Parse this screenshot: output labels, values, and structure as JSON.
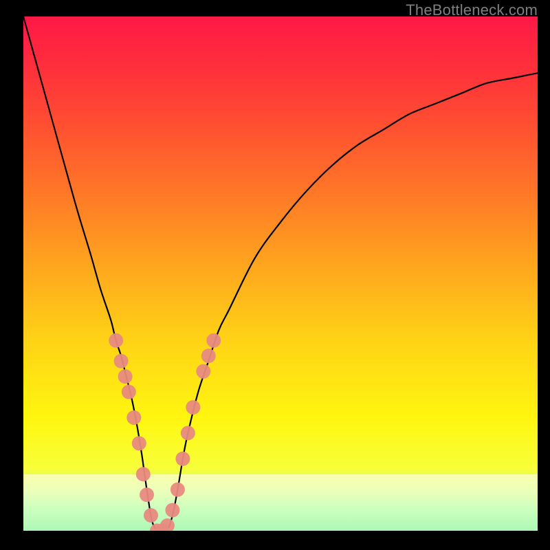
{
  "watermark": "TheBottleneck.com",
  "colors": {
    "frame": "#000000",
    "curve": "#000000",
    "marker_fill": "#e88a80",
    "marker_stroke": "#e88a80",
    "highlight_band": "rgba(255,255,220,0.68)"
  },
  "chart_data": {
    "type": "line",
    "title": "",
    "xlabel": "",
    "ylabel": "",
    "xlim": [
      0,
      100
    ],
    "ylim": [
      0,
      100
    ],
    "grid": false,
    "x": [
      0,
      5,
      10,
      13,
      15,
      17,
      18,
      19,
      20,
      21,
      22,
      23,
      24,
      25,
      26,
      27,
      28,
      29,
      30,
      31,
      32,
      34,
      36,
      38,
      40,
      45,
      50,
      55,
      60,
      65,
      70,
      75,
      80,
      85,
      90,
      95,
      100
    ],
    "y": [
      100,
      82,
      64,
      54,
      47,
      41,
      37,
      34,
      30,
      26,
      21,
      15,
      8,
      2,
      0,
      0,
      0,
      3,
      8,
      14,
      19,
      27,
      33,
      39,
      43,
      53,
      60,
      66,
      71,
      75,
      78,
      81,
      83,
      85,
      87,
      88,
      89
    ],
    "vertex_x": 26.5,
    "highlight_band": {
      "y_from": 0,
      "y_to": 11
    },
    "markers": [
      {
        "x": 18.0,
        "y": 37
      },
      {
        "x": 19.0,
        "y": 33
      },
      {
        "x": 19.8,
        "y": 30
      },
      {
        "x": 20.5,
        "y": 27
      },
      {
        "x": 21.5,
        "y": 22
      },
      {
        "x": 22.5,
        "y": 17
      },
      {
        "x": 23.3,
        "y": 11
      },
      {
        "x": 24.0,
        "y": 7
      },
      {
        "x": 24.8,
        "y": 3
      },
      {
        "x": 26.0,
        "y": 0
      },
      {
        "x": 27.0,
        "y": 0
      },
      {
        "x": 28.0,
        "y": 1
      },
      {
        "x": 29.0,
        "y": 4
      },
      {
        "x": 30.0,
        "y": 8
      },
      {
        "x": 31.0,
        "y": 14
      },
      {
        "x": 32.0,
        "y": 19
      },
      {
        "x": 33.0,
        "y": 24
      },
      {
        "x": 35.0,
        "y": 31
      },
      {
        "x": 36.0,
        "y": 34
      },
      {
        "x": 37.0,
        "y": 37
      }
    ]
  }
}
